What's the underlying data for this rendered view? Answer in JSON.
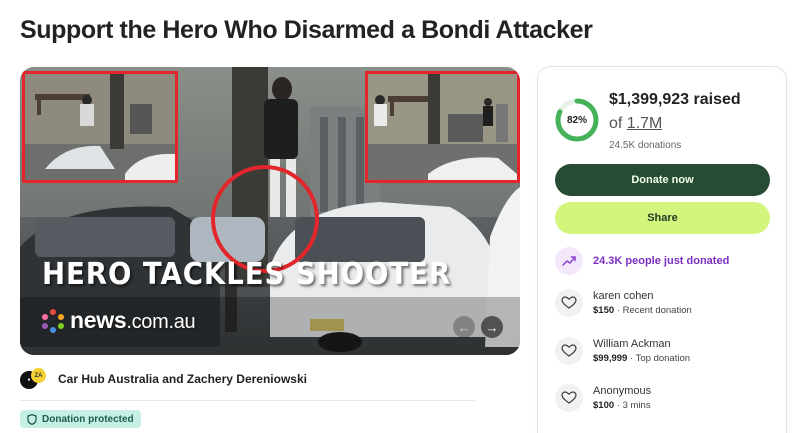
{
  "page": {
    "title": "Support the Hero Who Disarmed a Bondi Attacker"
  },
  "media": {
    "overlay_caption": "HERO TACKLES SHOOTER",
    "logo_text": "news",
    "logo_suffix": ".com.au",
    "prev_icon": "chevron-left-icon",
    "next_icon": "chevron-right-icon"
  },
  "organizer": {
    "name": "Car Hub Australia and Zachery Dereniowski",
    "avatar_badge": "ZA"
  },
  "badge": {
    "label": "Donation protected",
    "icon": "shield-icon",
    "color": "#c6efe6"
  },
  "progress": {
    "percent_label": "82%",
    "fraction": 0.82,
    "raised": "$1,399,923 raised",
    "goal_prefix": "of",
    "goal": "1.7M",
    "donations": "24.5K donations",
    "ring_color": "#45b25a"
  },
  "actions": {
    "donate_label": "Donate now",
    "share_label": "Share",
    "donate_color": "#274b35",
    "share_color": "#d3f57e"
  },
  "trend": {
    "text": "24.3K people just donated",
    "icon": "trending-up-icon",
    "color": "#7c2fbf"
  },
  "donors": [
    {
      "name": "karen cohen",
      "amount": "$150",
      "note": "Recent donation"
    },
    {
      "name": "William Ackman",
      "amount": "$99,999",
      "note": "Top donation"
    },
    {
      "name": "Anonymous",
      "amount": "$100",
      "note": "3 mins"
    }
  ]
}
